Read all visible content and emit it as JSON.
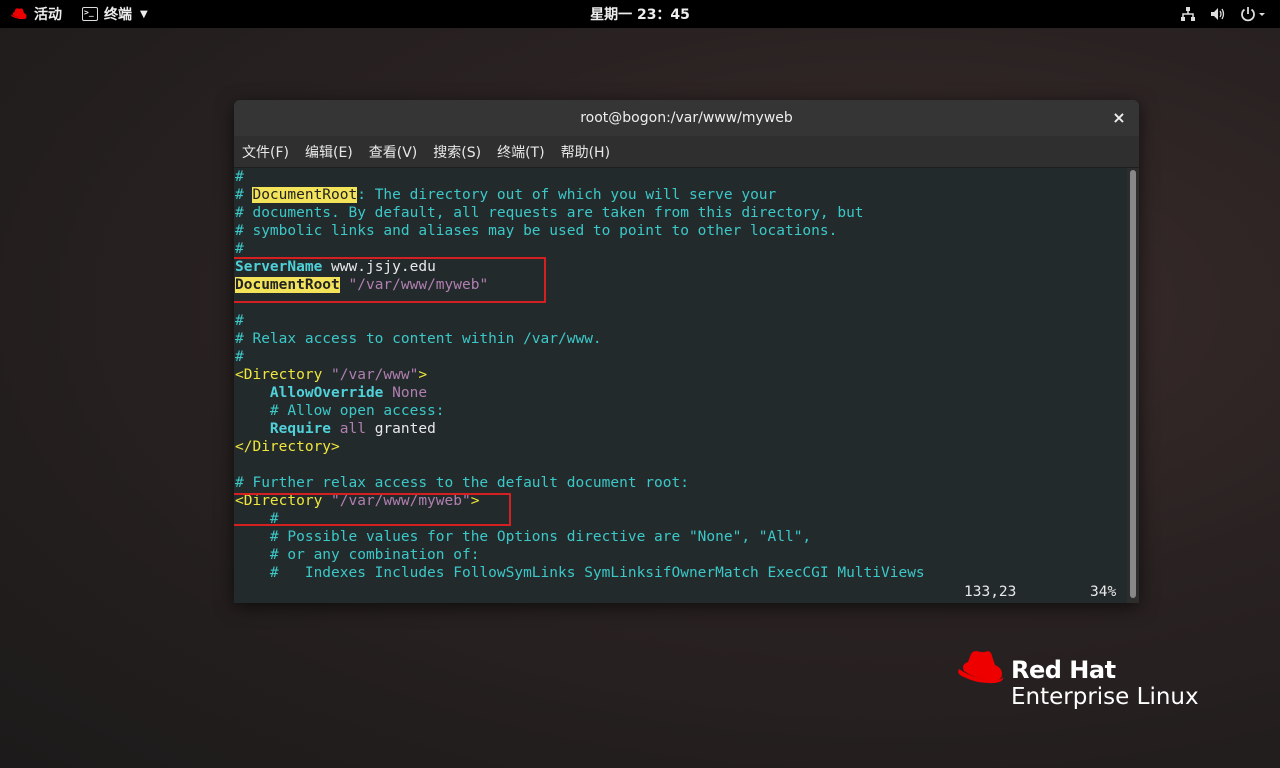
{
  "topbar": {
    "activities": "活动",
    "app_menu": "终端",
    "clock": "星期一 23：45",
    "icons": [
      "network-icon",
      "volume-icon",
      "power-icon"
    ]
  },
  "window": {
    "title": "root@bogon:/var/www/myweb",
    "close": "×",
    "menu": [
      "文件(F)",
      "编辑(E)",
      "查看(V)",
      "搜索(S)",
      "终端(T)",
      "帮助(H)"
    ]
  },
  "editor": {
    "lines": [
      [
        "#"
      ],
      [
        "# ",
        "DocumentRoot",
        ": The directory out of which you will serve your"
      ],
      [
        "# documents. By default, all requests are taken from this directory, but"
      ],
      [
        "# symbolic links and aliases may be used to point to other locations."
      ],
      [
        "#"
      ],
      [
        "ServerName",
        " www.jsjy.edu"
      ],
      [
        "DocumentRoot",
        " ",
        "\"/var/www/myweb\""
      ],
      [
        ""
      ],
      [
        "#"
      ],
      [
        "# Relax access to content within /var/www."
      ],
      [
        "#"
      ],
      [
        "<Directory ",
        "\"/var/www\"",
        ">"
      ],
      [
        "    ",
        "AllowOverride",
        " ",
        "None"
      ],
      [
        "    # Allow open access:"
      ],
      [
        "    ",
        "Require",
        " ",
        "all",
        " granted"
      ],
      [
        "</Directory>"
      ],
      [
        ""
      ],
      [
        "# Further relax access to the default document root:"
      ],
      [
        "<Directory ",
        "\"/var/www/myweb\"",
        ">"
      ],
      [
        "    #"
      ],
      [
        "    # Possible values for the Options directive are \"None\", \"All\","
      ],
      [
        "    # or any combination of:"
      ],
      [
        "    #   Indexes Includes FollowSymLinks SymLinksifOwnerMatch ExecCGI MultiViews"
      ]
    ],
    "position": "133,23",
    "percent": "34%"
  },
  "logo": {
    "brand": "Red Hat",
    "product": "Enterprise Linux"
  },
  "colors": {
    "terminal_bg": "#232a2c",
    "comment": "#3cc8c8",
    "tag": "#f0e63c",
    "keyword": "#50d0d8",
    "string": "#b07fb0",
    "search_highlight": "#f3e35a",
    "annotation_box": "#d42020",
    "redhat_red": "#ee0000"
  }
}
